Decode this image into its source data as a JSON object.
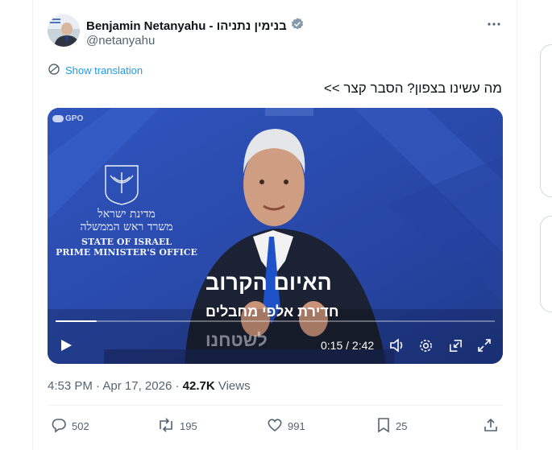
{
  "author": {
    "name": "Benjamin Netanyahu - בנימין נתניהו",
    "handle": "@netanyahu",
    "verified_icon": "verified-badge-icon"
  },
  "more_icon": "more-options-icon",
  "translation": {
    "label": "Show translation"
  },
  "tweet_text": "מה עשינו בצפון? הסבר קצר >>",
  "video": {
    "watermark": "GPO",
    "emblem_text": {
      "hebrew_line1": "מדינת ישראל",
      "hebrew_line2": "משרד ראש הממשלה",
      "english_line1": "STATE OF ISRAEL",
      "english_line2": "PRIME MINISTER'S OFFICE"
    },
    "caption_title": "האיום הקרוב",
    "caption_subtitle": "חדירת אלפי מחבלים",
    "caption_third": "לשטחנו",
    "time": "0:15 / 2:42",
    "progress_fraction": 0.093,
    "background_color": "#2b4aa8"
  },
  "meta": {
    "time": "4:53 PM",
    "separator": "·",
    "date": "Apr 17, 2026",
    "views_count": "42.7K",
    "views_label": "Views"
  },
  "actions": {
    "replies": "502",
    "reposts": "195",
    "likes": "991",
    "bookmarks": "25"
  },
  "colors": {
    "accent": "#1d9bf0",
    "muted": "#536471",
    "text": "#0f1419"
  }
}
